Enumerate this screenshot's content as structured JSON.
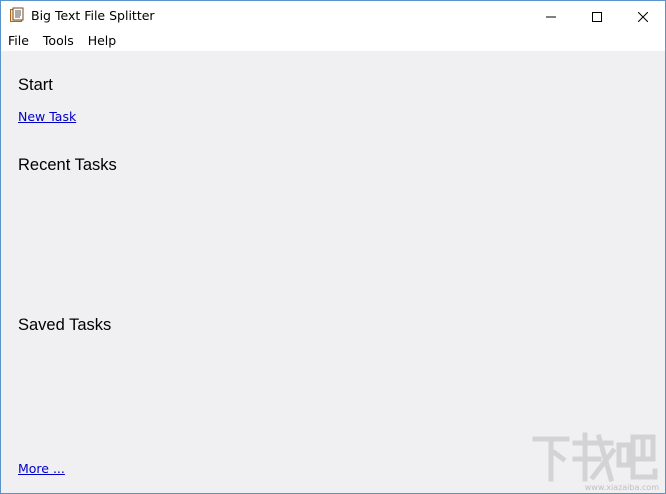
{
  "window": {
    "title": "Big Text File Splitter",
    "icon": "book-icon",
    "controls": {
      "minimize": "minimize-icon",
      "maximize": "maximize-icon",
      "close": "close-icon"
    }
  },
  "menu": {
    "items": [
      "File",
      "Tools",
      "Help"
    ]
  },
  "start": {
    "heading": "Start",
    "new_task_link": "New Task"
  },
  "recent": {
    "heading": "Recent Tasks",
    "items": []
  },
  "saved": {
    "heading": "Saved Tasks",
    "items": [],
    "more_link": "More ..."
  },
  "watermark": {
    "text": "下载吧",
    "sub": "www.xiazaiba.com"
  },
  "colors": {
    "content_bg": "#f0eff2",
    "link": "#0000c8",
    "border": "#5a93c9"
  }
}
